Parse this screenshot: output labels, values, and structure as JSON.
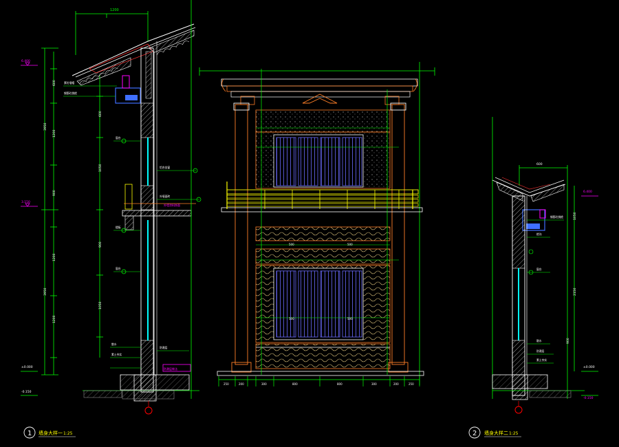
{
  "title_1": {
    "number": "1",
    "text": "墙身大样一",
    "scale": "1:25"
  },
  "title_2": {
    "number": "2",
    "text": "墙身大样二",
    "scale": "1:25"
  },
  "elevation_marks_left": [
    "±0.000",
    "-0.150"
  ],
  "elevation_marks_right": [
    "±0.000",
    "-0.150"
  ],
  "colors": {
    "background": "#000000",
    "green": "#00ff00",
    "yellow": "#ffff00",
    "white": "#ffffff",
    "cyan": "#00ffff",
    "magenta": "#ff00ff",
    "orange": "#ff7f27",
    "red": "#ff0000",
    "blue": "#3f6fff",
    "gray": "#8a8a8a",
    "dark_red": "#aa2a2a"
  }
}
